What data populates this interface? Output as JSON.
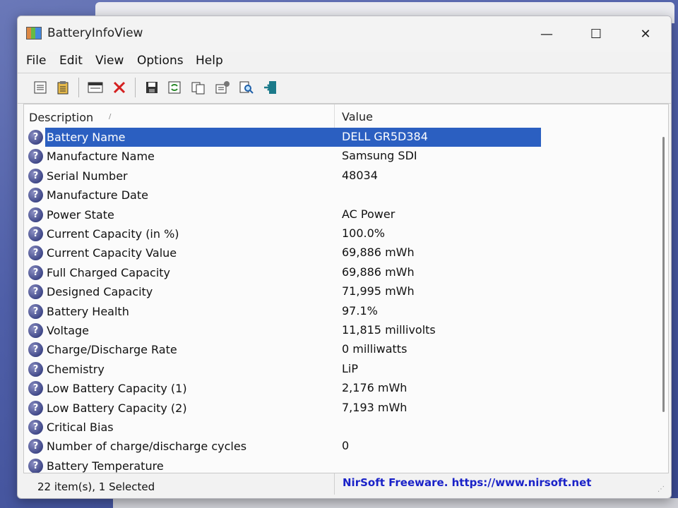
{
  "window": {
    "title": "BatteryInfoView",
    "minimize_glyph": "—",
    "maximize_glyph": "☐",
    "close_glyph": "✕"
  },
  "menu": [
    "File",
    "Edit",
    "View",
    "Options",
    "Help"
  ],
  "toolbar": [
    "properties-icon",
    "clipboard-icon",
    "window-icon",
    "delete-icon",
    "save-icon",
    "refresh-icon",
    "copy-icon",
    "options-icon",
    "find-icon",
    "exit-icon"
  ],
  "columns": {
    "description": "Description",
    "value": "Value",
    "sort_glyph": "/"
  },
  "row_icon_glyph": "?",
  "rows": [
    {
      "description": "Battery Name",
      "value": "DELL GR5D384",
      "selected": true
    },
    {
      "description": "Manufacture Name",
      "value": "Samsung SDI"
    },
    {
      "description": "Serial Number",
      "value": "48034"
    },
    {
      "description": "Manufacture Date",
      "value": ""
    },
    {
      "description": "Power State",
      "value": "AC Power"
    },
    {
      "description": "Current Capacity (in %)",
      "value": "100.0%"
    },
    {
      "description": "Current Capacity Value",
      "value": "69,886 mWh"
    },
    {
      "description": "Full Charged Capacity",
      "value": "69,886 mWh"
    },
    {
      "description": "Designed Capacity",
      "value": "71,995 mWh"
    },
    {
      "description": "Battery Health",
      "value": "97.1%"
    },
    {
      "description": "Voltage",
      "value": "11,815 millivolts"
    },
    {
      "description": "Charge/Discharge Rate",
      "value": "0 milliwatts"
    },
    {
      "description": "Chemistry",
      "value": "LiP"
    },
    {
      "description": "Low Battery Capacity (1)",
      "value": "2,176 mWh"
    },
    {
      "description": "Low Battery Capacity (2)",
      "value": "7,193 mWh"
    },
    {
      "description": "Critical Bias",
      "value": ""
    },
    {
      "description": "Number of charge/discharge cycles",
      "value": "0"
    },
    {
      "description": "Battery Temperature",
      "value": ""
    }
  ],
  "status": {
    "items": "22 item(s), 1 Selected",
    "link": "NirSoft Freeware. https://www.nirsoft.net"
  },
  "colors": {
    "selection": "#2b5fc1",
    "link": "#1a22c8"
  }
}
